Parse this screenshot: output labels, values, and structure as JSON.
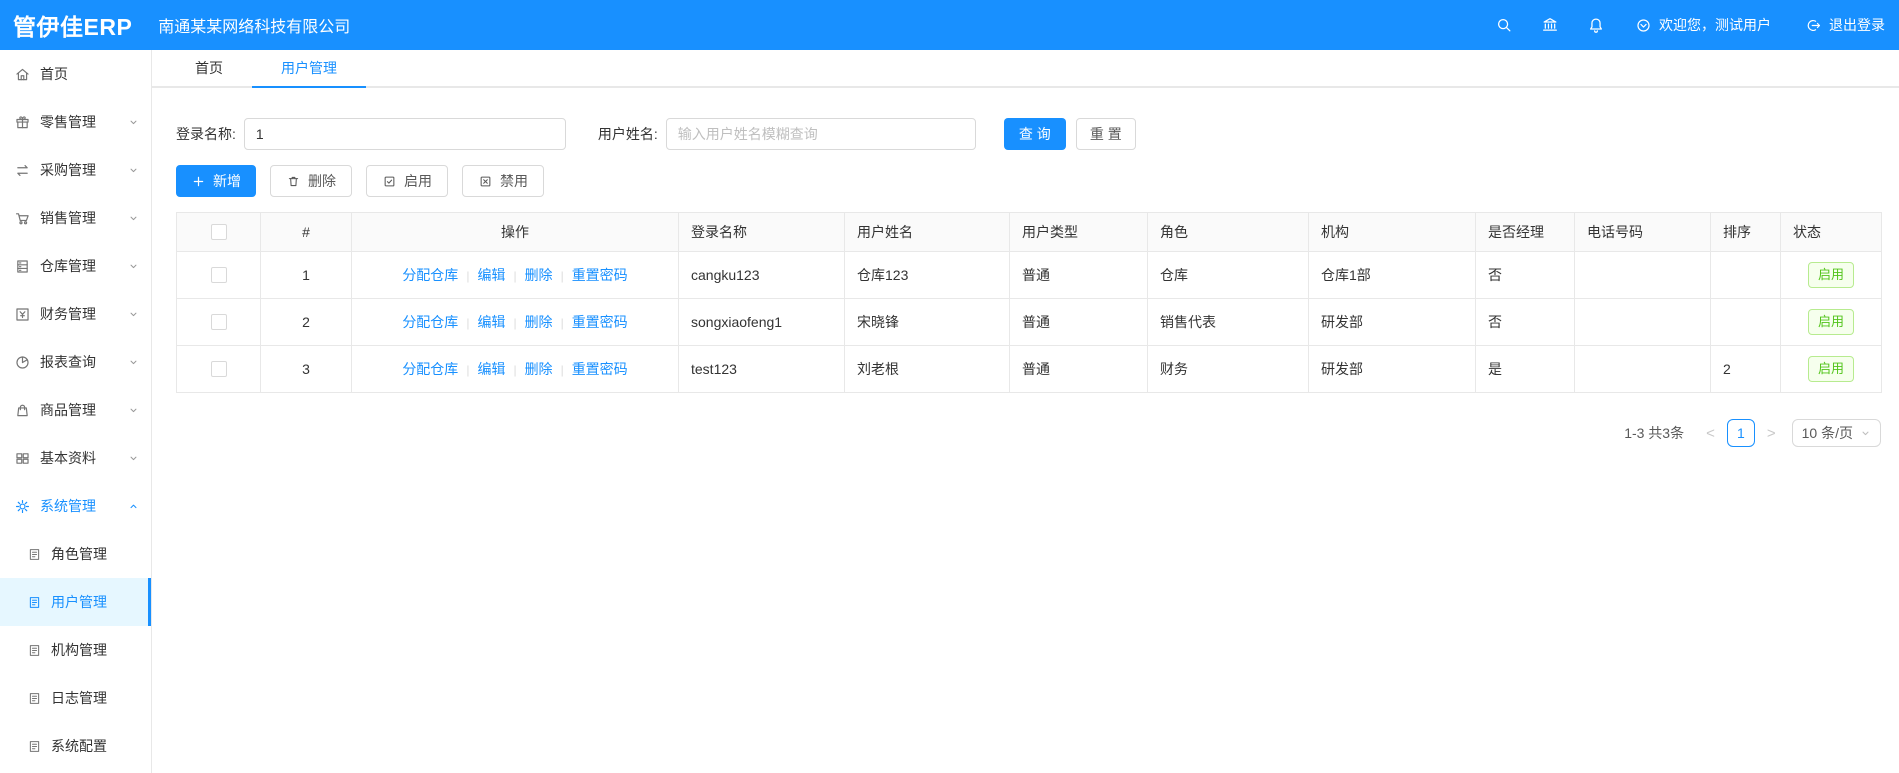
{
  "topbar": {
    "logo": "管伊佳ERP",
    "company": "南通某某网络科技有限公司",
    "welcome": "欢迎您，测试用户",
    "logout": "退出登录"
  },
  "sidebar": {
    "items": [
      {
        "label": "首页"
      },
      {
        "label": "零售管理"
      },
      {
        "label": "采购管理"
      },
      {
        "label": "销售管理"
      },
      {
        "label": "仓库管理"
      },
      {
        "label": "财务管理"
      },
      {
        "label": "报表查询"
      },
      {
        "label": "商品管理"
      },
      {
        "label": "基本资料"
      },
      {
        "label": "系统管理"
      }
    ],
    "system_children": [
      {
        "label": "角色管理"
      },
      {
        "label": "用户管理"
      },
      {
        "label": "机构管理"
      },
      {
        "label": "日志管理"
      },
      {
        "label": "系统配置"
      }
    ]
  },
  "tabs": [
    {
      "label": "首页"
    },
    {
      "label": "用户管理"
    }
  ],
  "filter": {
    "login_label": "登录名称:",
    "login_value": "1",
    "name_label": "用户姓名:",
    "name_placeholder": "输入用户姓名模糊查询",
    "search_label": "查 询",
    "reset_label": "重 置"
  },
  "toolbar": {
    "add_label": "新增",
    "delete_label": "删除",
    "enable_label": "启用",
    "disable_label": "禁用"
  },
  "table": {
    "headers": {
      "index": "#",
      "actions": "操作",
      "login": "登录名称",
      "name": "用户姓名",
      "type": "用户类型",
      "role": "角色",
      "org": "机构",
      "manager": "是否经理",
      "phone": "电话号码",
      "sort": "排序",
      "status": "状态"
    },
    "action_links": [
      "分配仓库",
      "编辑",
      "删除",
      "重置密码"
    ],
    "rows": [
      {
        "index": "1",
        "login": "cangku123",
        "name": "仓库123",
        "type": "普通",
        "role": "仓库",
        "org": "仓库1部",
        "manager": "否",
        "phone": "",
        "sort": "",
        "status": "启用"
      },
      {
        "index": "2",
        "login": "songxiaofeng1",
        "name": "宋晓锋",
        "type": "普通",
        "role": "销售代表",
        "org": "研发部",
        "manager": "否",
        "phone": "",
        "sort": "",
        "status": "启用"
      },
      {
        "index": "3",
        "login": "test123",
        "name": "刘老根",
        "type": "普通",
        "role": "财务",
        "org": "研发部",
        "manager": "是",
        "phone": "",
        "sort": "2",
        "status": "启用"
      }
    ]
  },
  "pagination": {
    "total": "1-3 共3条",
    "prev": "<",
    "page": "1",
    "next": ">",
    "page_size": "10 条/页"
  },
  "colors": {
    "primary": "#1890ff",
    "success": "#52c41a",
    "success_bg": "#f6ffed",
    "success_border": "#b7eb8f"
  }
}
